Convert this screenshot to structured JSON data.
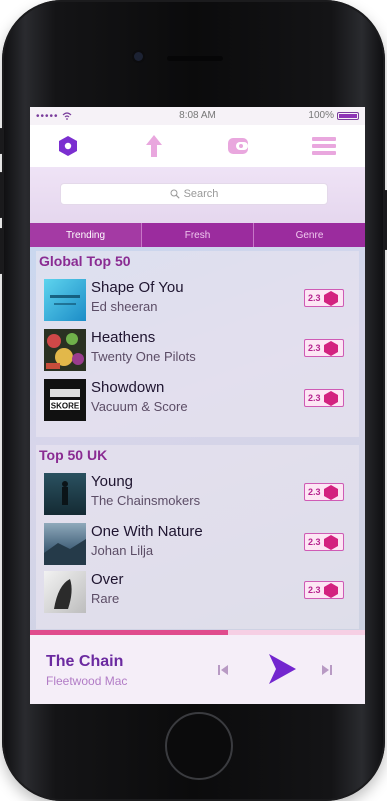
{
  "status_bar": {
    "signal": "•••••",
    "time": "8:08 AM",
    "battery": "100%"
  },
  "nav": {
    "items": [
      {
        "name": "home",
        "icon": "hexagon-icon",
        "active": true
      },
      {
        "name": "upload",
        "icon": "arrow-up-icon",
        "active": false
      },
      {
        "name": "wallet",
        "icon": "wallet-icon",
        "active": false
      },
      {
        "name": "menu",
        "icon": "hamburger-menu-icon",
        "active": false
      }
    ]
  },
  "search": {
    "placeholder": "Search",
    "icon": "magnifier-icon"
  },
  "tabs": [
    {
      "label": "Trending",
      "active": true
    },
    {
      "label": "Fresh",
      "active": false
    },
    {
      "label": "Genre",
      "active": false
    }
  ],
  "sections": [
    {
      "title": "Global Top 50",
      "tracks": [
        {
          "title": "Shape Of You",
          "artist": "Ed sheeran",
          "badge": "2.3",
          "cover_colors": [
            "#5dc5e8",
            "#1e8fc4"
          ]
        },
        {
          "title": "Heathens",
          "artist": "Twenty One Pilots",
          "badge": "2.3",
          "cover_colors": [
            "#2a2f1f",
            "#c03a3a"
          ]
        },
        {
          "title": "Showdown",
          "artist": "Vacuum & Score",
          "badge": "2.3",
          "cover_colors": [
            "#111111",
            "#555555"
          ],
          "cover_text": "SKORE"
        }
      ]
    },
    {
      "title": "Top 50 UK",
      "tracks": [
        {
          "title": "Young",
          "artist": "The Chainsmokers",
          "badge": "2.3",
          "cover_colors": [
            "#1f3b46",
            "#6e8f9a"
          ]
        },
        {
          "title": "One With Nature",
          "artist": "Johan Lilja",
          "badge": "2.3",
          "cover_colors": [
            "#2f4a63",
            "#9bb4c4"
          ]
        },
        {
          "title": "Over",
          "artist": "Rare",
          "badge": "2.3",
          "cover_colors": [
            "#e7e7e7",
            "#2a2a2a"
          ]
        }
      ]
    }
  ],
  "player": {
    "title": "The Chain",
    "artist": "Fleetwood Mac",
    "progress": 0.59
  },
  "colors": {
    "accent": "#8e2fb2",
    "tab_bar": "#9b2c9e",
    "badge_pink": "#d3227f",
    "progress": "#e04b8d"
  }
}
